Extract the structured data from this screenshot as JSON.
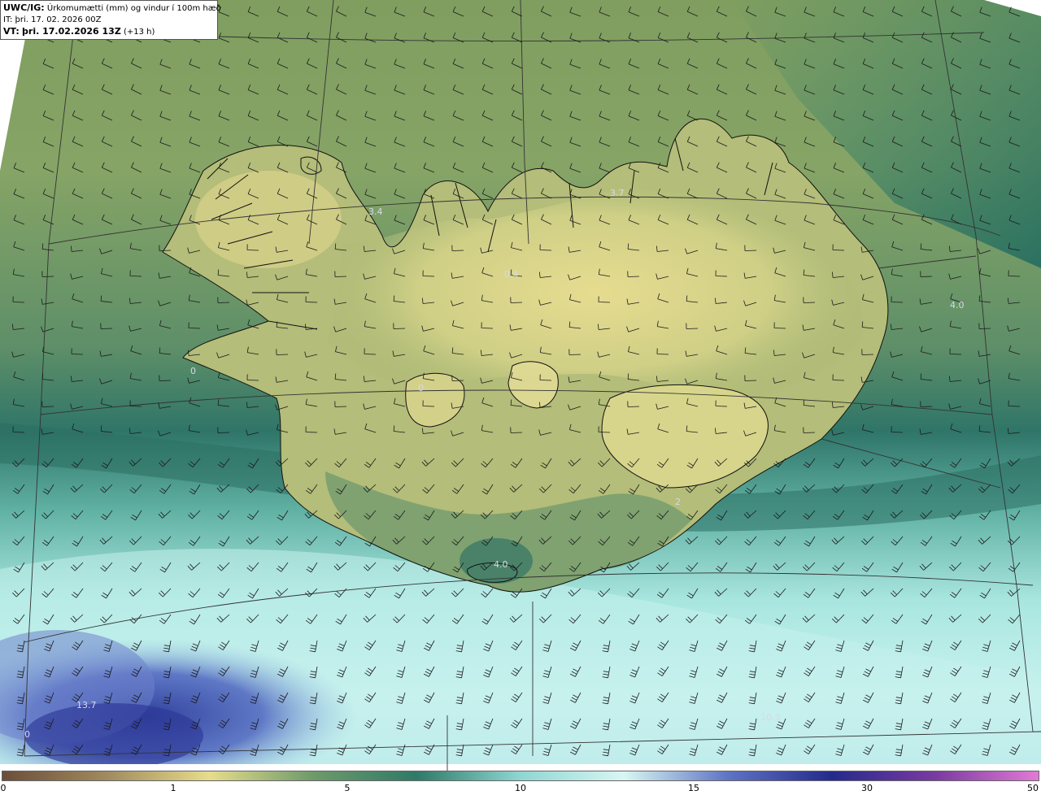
{
  "header": {
    "model": "UWC/IG:",
    "title": "Úrkomumætti (mm) og vindur í 100m hæð",
    "init_label": "IT:",
    "init_time": "þri. 17. 02. 2026 00Z",
    "valid_label": "VT:",
    "valid_time": "þri. 17.02.2026 13Z",
    "lead_time": "(+13 h)"
  },
  "map_values": [
    "3.4",
    "3.7",
    "0.4",
    "4.0",
    "0",
    "0",
    "2",
    "4.0",
    "13.7",
    "10.3",
    "0"
  ],
  "colorbar": {
    "ticks": [
      "0",
      "1",
      "5",
      "10",
      "15",
      "30",
      "50"
    ],
    "colors": [
      "#6b4e3a",
      "#a08a5e",
      "#e6dc8c",
      "#6e9a6a",
      "#2f7a68",
      "#8fd6d2",
      "#d8f6f2",
      "#5f74c4",
      "#242a8c",
      "#7a3aa0",
      "#e27ad6"
    ]
  }
}
